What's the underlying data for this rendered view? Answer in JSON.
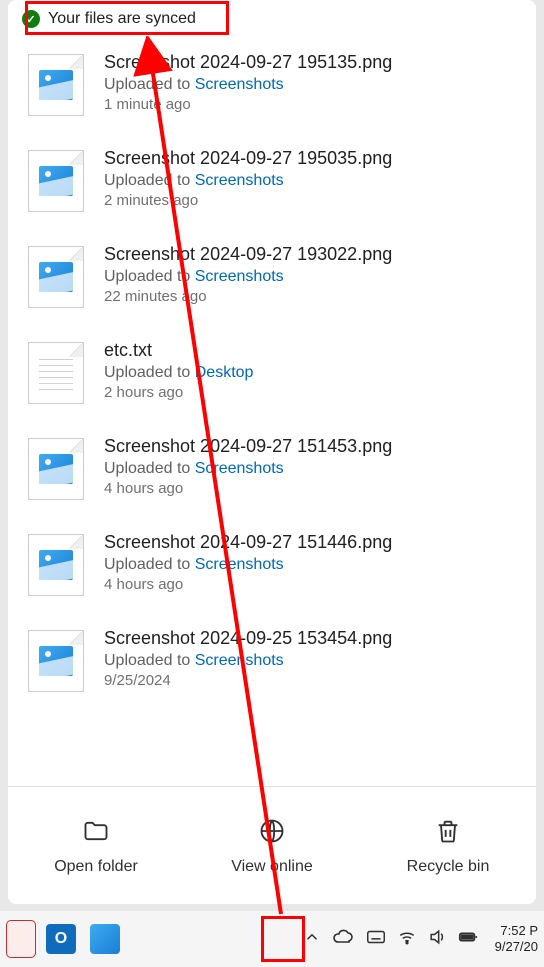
{
  "header": {
    "status_text": "Your files are synced"
  },
  "files": [
    {
      "name": "Screenshot 2024-09-27 195135.png",
      "prefix": "Uploaded to",
      "location": "Screenshots",
      "time": "1 minute ago",
      "type": "image"
    },
    {
      "name": "Screenshot 2024-09-27 195035.png",
      "prefix": "Uploaded to",
      "location": "Screenshots",
      "time": "2 minutes ago",
      "type": "image"
    },
    {
      "name": "Screenshot 2024-09-27 193022.png",
      "prefix": "Uploaded to",
      "location": "Screenshots",
      "time": "22 minutes ago",
      "type": "image"
    },
    {
      "name": "etc.txt",
      "prefix": "Uploaded to",
      "location": "Desktop",
      "time": "2 hours ago",
      "type": "text"
    },
    {
      "name": "Screenshot 2024-09-27 151453.png",
      "prefix": "Uploaded to",
      "location": "Screenshots",
      "time": "4 hours ago",
      "type": "image"
    },
    {
      "name": "Screenshot 2024-09-27 151446.png",
      "prefix": "Uploaded to",
      "location": "Screenshots",
      "time": "4 hours ago",
      "type": "image"
    },
    {
      "name": "Screenshot 2024-09-25 153454.png",
      "prefix": "Uploaded to",
      "location": "Screenshots",
      "time": "9/25/2024",
      "type": "image"
    }
  ],
  "actions": {
    "open_folder": "Open folder",
    "view_online": "View online",
    "recycle_bin": "Recycle bin"
  },
  "taskbar": {
    "time": "7:52 P",
    "date": "9/27/20"
  }
}
